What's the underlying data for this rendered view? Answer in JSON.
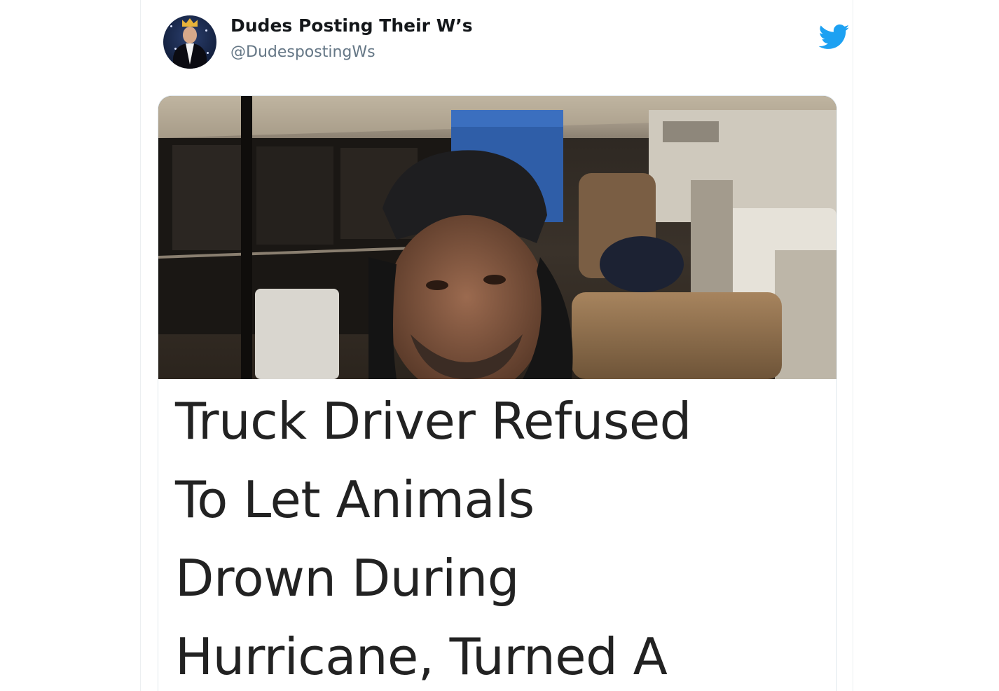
{
  "tweet": {
    "author_name": "Dudes Posting Their W’s",
    "author_handle": "@DudespostingWs",
    "platform_icon": "twitter-bird-icon",
    "brand_color": "#1DA1F2"
  },
  "article": {
    "headline_lines": [
      "Truck Driver Refused",
      "To Let Animals",
      "Drown During",
      "Hurricane, Turned A"
    ]
  }
}
